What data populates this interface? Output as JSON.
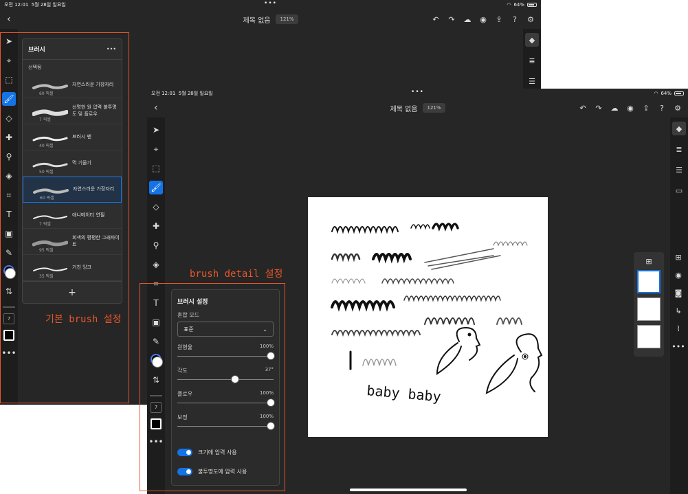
{
  "back_window": {
    "status": {
      "time": "오전 12:01",
      "date": "5월 28일 일요일",
      "battery": "64%"
    },
    "doc_title": "제목 없음",
    "zoom": "121%"
  },
  "brush_panel": {
    "title": "브러시",
    "more": "•••",
    "section": "선택됨",
    "items": [
      {
        "name": "자연스러운 기장자리",
        "size": "60 픽셀"
      },
      {
        "name": "선명한 원 압력 불투명도 및 플로우",
        "size": "7 픽셀"
      },
      {
        "name": "브러시 펜",
        "size": "40 픽셀"
      },
      {
        "name": "먹 기울기",
        "size": "50 픽셀"
      },
      {
        "name": "자연스러운 가장자리",
        "size": "60 픽셀"
      },
      {
        "name": "애니메이터 연필",
        "size": "7 픽셀"
      },
      {
        "name": "회색의 평평한 그래파이트",
        "size": "95 픽셀"
      },
      {
        "name": "거친 잉크",
        "size": "35 픽셀"
      }
    ],
    "add": "+"
  },
  "annotations": {
    "basic": "기본 brush 설정",
    "detail": "brush detail 설정"
  },
  "front_window": {
    "status": {
      "time": "오전 12:01",
      "date": "5월 28일 일요일",
      "battery": "64%"
    },
    "doc_title": "제목 없음",
    "zoom": "121%"
  },
  "brush_settings": {
    "title": "브러시 설정",
    "blend_label": "혼합 모드",
    "blend_value": "표준",
    "sliders": [
      {
        "label": "원형율",
        "value": "100%",
        "fraction": 1.0
      },
      {
        "label": "각도",
        "value": "37°",
        "fraction": 0.6
      },
      {
        "label": "플로우",
        "value": "100%",
        "fraction": 1.0
      },
      {
        "label": "보정",
        "value": "100%",
        "fraction": 1.0
      }
    ],
    "toggles": [
      {
        "label": "크기에 압력 사용",
        "on": true
      },
      {
        "label": "불투명도에 압력 사용",
        "on": true
      }
    ]
  },
  "canvas_text": {
    "baby": "baby baby"
  },
  "brush_size_value": "7",
  "colors": {
    "accent": "#1473e6",
    "annotation": "#e8572b",
    "app_bg": "#262626"
  }
}
